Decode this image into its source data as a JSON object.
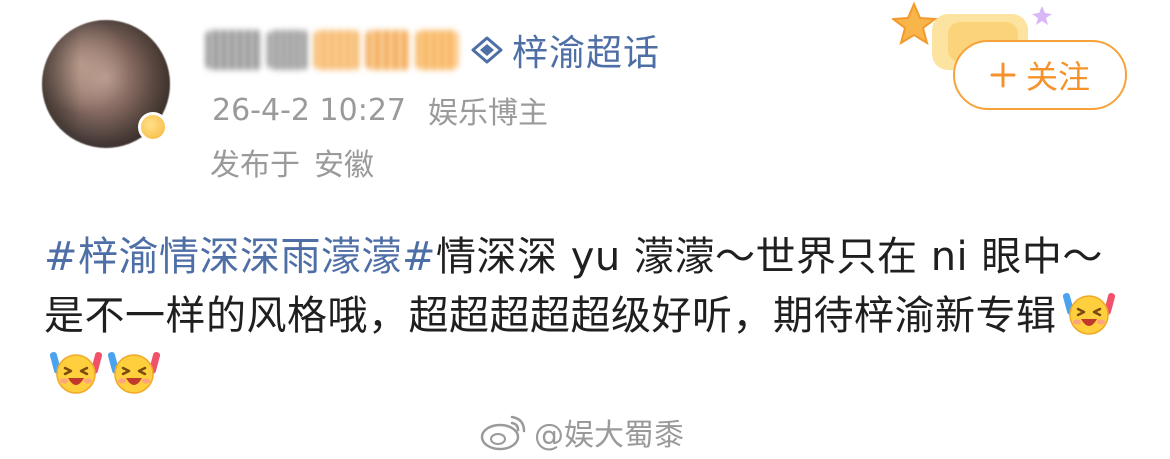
{
  "post": {
    "author": {
      "avatar_icon": "avatar-photo-icon",
      "supertopic_icon": "supertopic-diamond-icon",
      "supertopic_label": "梓渝超话"
    },
    "meta": {
      "timestamp": "26-4-2 10:27",
      "role": "娱乐博主",
      "location_prefix": "发布于",
      "location": "安徽"
    },
    "follow": {
      "icon": "plus-icon",
      "label": "关注"
    },
    "body": {
      "hashtag": "#梓渝情深深雨濛濛#",
      "line1_text": "情深深 yu 濛濛～世界只在 ni 眼中～是不一样的风格哦，超超超超超级好听，期待梓渝新专辑",
      "emojis": [
        "cheer-emoji-icon",
        "cheer-emoji-icon",
        "cheer-emoji-icon"
      ]
    }
  },
  "watermark": {
    "logo_icon": "weibo-logo-icon",
    "text": "@娱大蜀黍"
  },
  "colors": {
    "link": "#4e6ea6",
    "meta": "#9a9a9a",
    "follow_accent": "#f5922a",
    "follow_border": "#f7a23a"
  }
}
